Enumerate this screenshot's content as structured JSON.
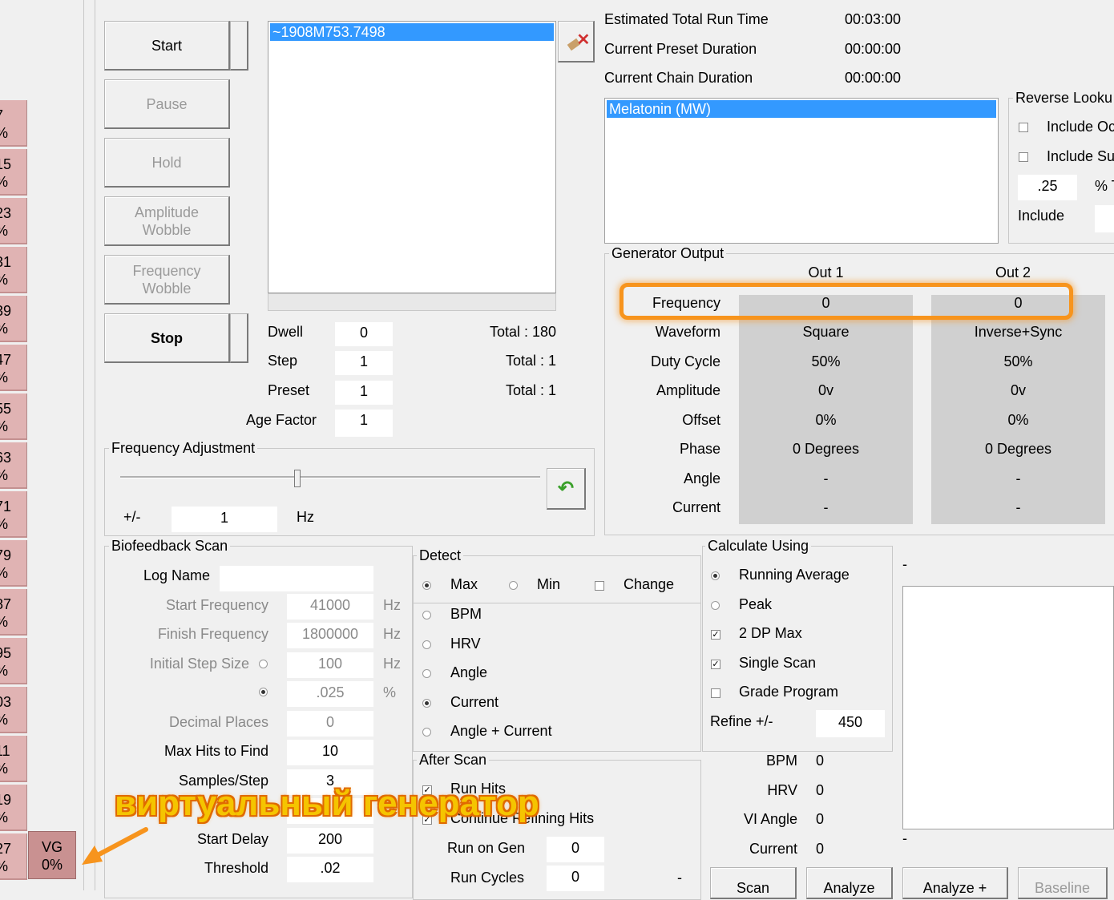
{
  "side_rows": [
    {
      "n": "7",
      "p": "%"
    },
    {
      "n": "15",
      "p": "%"
    },
    {
      "n": "23",
      "p": "%"
    },
    {
      "n": "31",
      "p": "%"
    },
    {
      "n": "39",
      "p": "%"
    },
    {
      "n": "47",
      "p": "%"
    },
    {
      "n": "55",
      "p": "%"
    },
    {
      "n": "63",
      "p": "%"
    },
    {
      "n": "71",
      "p": "%"
    },
    {
      "n": "79",
      "p": "%"
    },
    {
      "n": "87",
      "p": "%"
    },
    {
      "n": "95",
      "p": "%"
    },
    {
      "n": "03",
      "p": "%"
    },
    {
      "n": "11",
      "p": "%"
    },
    {
      "n": "19",
      "p": "%"
    },
    {
      "n": "27",
      "p": "%"
    }
  ],
  "vg_tile": {
    "label": "VG",
    "value": "0%"
  },
  "controls": {
    "start": "Start",
    "pause": "Pause",
    "hold": "Hold",
    "amp_wobble_1": "Amplitude",
    "amp_wobble_2": "Wobble",
    "freq_wobble_1": "Frequency",
    "freq_wobble_2": "Wobble",
    "stop": "Stop"
  },
  "program_list": {
    "selected": "~1908M753.7498"
  },
  "counters": {
    "dwell_label": "Dwell",
    "dwell_value": "0",
    "dwell_total": "Total : 180",
    "step_label": "Step",
    "step_value": "1",
    "step_total": "Total : 1",
    "preset_label": "Preset",
    "preset_value": "1",
    "preset_total": "Total : 1",
    "age_label": "Age Factor",
    "age_value": "1"
  },
  "run_times": {
    "est_label": "Estimated Total Run Time",
    "est_value": "00:03:00",
    "preset_label": "Current Preset Duration",
    "preset_value": "00:00:00",
    "chain_label": "Current Chain Duration",
    "chain_value": "00:00:00"
  },
  "preset_list": {
    "selected": "Melatonin (MW)"
  },
  "reverse_lookup": {
    "title": "Reverse Looku",
    "include_od": "Include Oc",
    "include_su": "Include Su",
    "pct_value": ".25",
    "pct_label": "% T",
    "include_label": "Include"
  },
  "freq_adjust": {
    "title": "Frequency Adjustment",
    "pm_label": "+/-",
    "value": "1",
    "unit": "Hz",
    "slider_position": 0.42
  },
  "generator": {
    "title": "Generator Output",
    "out1": "Out 1",
    "out2": "Out 2",
    "rows": [
      {
        "label": "Frequency",
        "o1": "0",
        "o2": "0"
      },
      {
        "label": "Waveform",
        "o1": "Square",
        "o2": "Inverse+Sync"
      },
      {
        "label": "Duty Cycle",
        "o1": "50%",
        "o2": "50%"
      },
      {
        "label": "Amplitude",
        "o1": "0v",
        "o2": "0v"
      },
      {
        "label": "Offset",
        "o1": "0%",
        "o2": "0%"
      },
      {
        "label": "Phase",
        "o1": "0 Degrees",
        "o2": "0 Degrees"
      },
      {
        "label": "Angle",
        "o1": "-",
        "o2": "-"
      },
      {
        "label": "Current",
        "o1": "-",
        "o2": "-"
      }
    ]
  },
  "biofeedback": {
    "title": "Biofeedback Scan",
    "log_name_label": "Log Name",
    "log_name_value": "",
    "start_freq_label": "Start Frequency",
    "start_freq_value": "41000",
    "start_freq_unit": "Hz",
    "finish_freq_label": "Finish Frequency",
    "finish_freq_value": "1800000",
    "finish_freq_unit": "Hz",
    "init_step_label": "Initial Step Size",
    "init_step_value": "100",
    "init_step_unit": "Hz",
    "pct_step_value": ".025",
    "pct_step_unit": "%",
    "decimal_label": "Decimal Places",
    "decimal_value": "0",
    "maxhits_label": "Max Hits to Find",
    "maxhits_value": "10",
    "samples_label": "Samples/Step",
    "samples_value": "3",
    "startdelay_label": "Start Delay",
    "startdelay_value": "200",
    "threshold_label": "Threshold",
    "threshold_value": ".02"
  },
  "detect": {
    "title": "Detect",
    "max": "Max",
    "min": "Min",
    "change": "Change",
    "bpm": "BPM",
    "hrv": "HRV",
    "angle": "Angle",
    "current": "Current",
    "angle_current": "Angle + Current"
  },
  "after_scan": {
    "title": "After Scan",
    "run_hits": "Run Hits",
    "continue_refining": "Continue Refining Hits",
    "run_on_gen_label": "Run on Gen",
    "run_on_gen_value": "0",
    "run_cycles_label": "Run Cycles",
    "run_cycles_value": "0",
    "dash": "-"
  },
  "calc_using": {
    "title": "Calculate Using",
    "running_avg": "Running Average",
    "peak": "Peak",
    "dp_max": "2 DP Max",
    "single_scan": "Single Scan",
    "grade": "Grade Program",
    "refine_label": "Refine +/-",
    "refine_value": "450"
  },
  "readings": {
    "bpm_label": "BPM",
    "bpm_value": "0",
    "hrv_label": "HRV",
    "hrv_value": "0",
    "vi_label": "VI Angle",
    "vi_value": "0",
    "current_label": "Current",
    "current_value": "0"
  },
  "right_panel": {
    "dash_top": "-",
    "dash_bottom": "-"
  },
  "bottom_buttons": {
    "scan": "Scan",
    "analyze": "Analyze",
    "analyze_plus": "Analyze +",
    "baseline": "Baseline"
  },
  "annotation": {
    "text": "виртуальный генератор",
    "highlight_color": "#f7941d",
    "text_color": "#f5c400"
  }
}
